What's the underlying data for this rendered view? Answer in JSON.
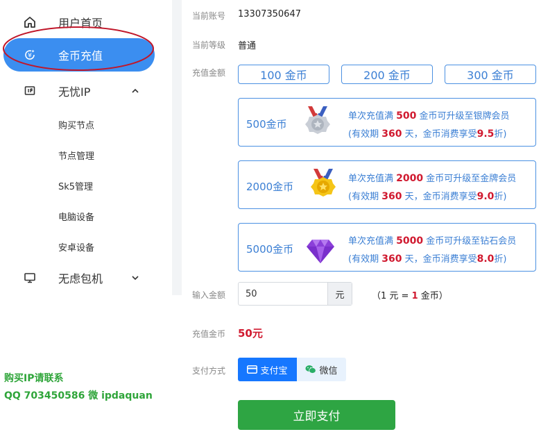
{
  "sidebar": {
    "items": [
      {
        "label": "用户首页",
        "icon": "home-icon"
      },
      {
        "label": "金币充值",
        "icon": "coin-recharge-icon",
        "active": true
      },
      {
        "label": "无忧IP",
        "icon": "ip-card-icon",
        "expanded": true
      },
      {
        "label": "无虑包机",
        "icon": "monitor-icon",
        "expanded": false
      }
    ],
    "subitems": [
      "购买节点",
      "节点管理",
      "Sk5管理",
      "电脑设备",
      "安卓设备"
    ],
    "active_color": "#3b8ef0"
  },
  "contact": {
    "line1": "购买IP请联系",
    "line2": "QQ  703450586 微 ipdaquan"
  },
  "account": {
    "label": "当前账号",
    "value": "13307350647"
  },
  "level": {
    "label": "当前等级",
    "value": "普通"
  },
  "amount": {
    "label": "充值金额",
    "options": [
      "100 金币",
      "200 金币",
      "300 金币"
    ],
    "packages": [
      {
        "amount": "500金币",
        "medal": "silver-medal-icon",
        "pre": "单次充值满 ",
        "num": "500",
        "mid": " 金币可升级至银牌会员",
        "l2a": "(有效期 ",
        "days": "360",
        "l2b": " 天，金币消费享受",
        "disc": "9.5",
        "l2c": "折)"
      },
      {
        "amount": "2000金币",
        "medal": "gold-medal-icon",
        "pre": "单次充值满 ",
        "num": "2000",
        "mid": " 金币可升级至金牌会员",
        "l2a": "(有效期 ",
        "days": "360",
        "l2b": " 天，金币消费享受",
        "disc": "9.0",
        "l2c": "折)"
      },
      {
        "amount": "5000金币",
        "medal": "diamond-icon",
        "pre": "单次充值满 ",
        "num": "5000",
        "mid": " 金币可升级至钻石会员",
        "l2a": "(有效期 ",
        "days": "360",
        "l2b": " 天，金币消费享受",
        "disc": "8.0",
        "l2c": "折)"
      }
    ]
  },
  "input": {
    "label": "输入金额",
    "value": "50",
    "unit": "元",
    "rate_pre": "（1 元 = ",
    "rate_num": "1",
    "rate_post": " 金币）"
  },
  "paid": {
    "label": "充值金币",
    "value": "50元"
  },
  "payment": {
    "label": "支付方式",
    "alipay": "支付宝",
    "wechat": "微信"
  },
  "submit": {
    "label": "立即支付"
  },
  "colors": {
    "primary": "#3b8ef0",
    "accent_red": "#d0192f",
    "green": "#2ea543",
    "alipay": "#1677ff"
  }
}
